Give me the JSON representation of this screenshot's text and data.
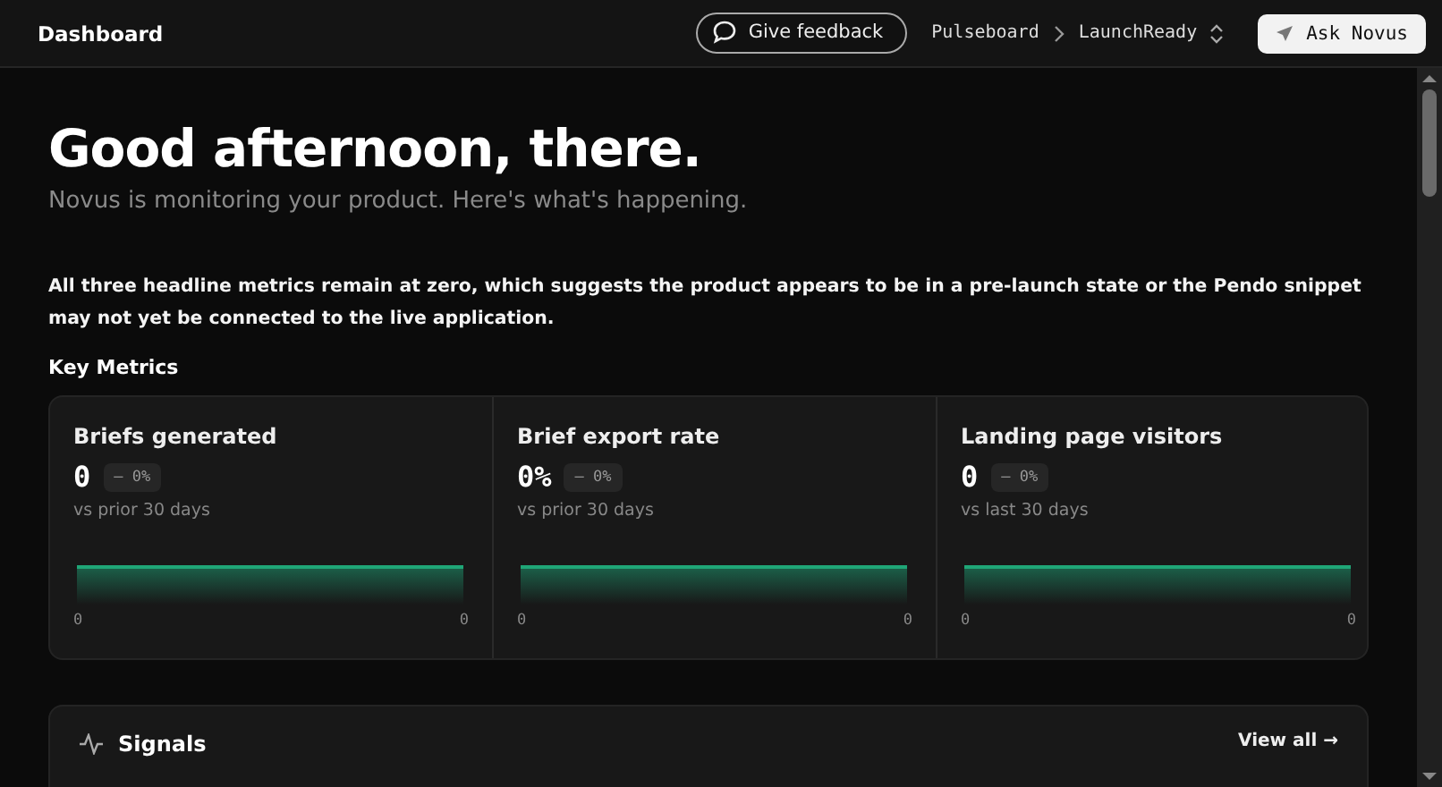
{
  "topbar": {
    "title": "Dashboard",
    "feedback_button": "Give feedback",
    "breadcrumb": [
      "Pulseboard",
      "LaunchReady"
    ],
    "ask_button": "Ask Novus"
  },
  "greeting": {
    "title": "Good afternoon, there.",
    "subtitle": "Novus is monitoring your product. Here's what's happening."
  },
  "summary": "All three headline metrics remain at zero, which suggests the product appears to be in a pre-launch state or the Pendo snippet may not yet be connected to the live application.",
  "key_metrics": {
    "title": "Key Metrics",
    "cards": [
      {
        "label": "Briefs generated",
        "value": "0",
        "change": "– 0%",
        "period": "vs prior 30 days",
        "axis_start": "0",
        "axis_end": "0"
      },
      {
        "label": "Brief export rate",
        "value": "0%",
        "change": "– 0%",
        "period": "vs prior 30 days",
        "axis_start": "0",
        "axis_end": "0"
      },
      {
        "label": "Landing page visitors",
        "value": "0",
        "change": "– 0%",
        "period": "vs last 30 days",
        "axis_start": "0",
        "axis_end": "0"
      }
    ]
  },
  "signals": {
    "title": "Signals",
    "link": "View all →"
  }
}
